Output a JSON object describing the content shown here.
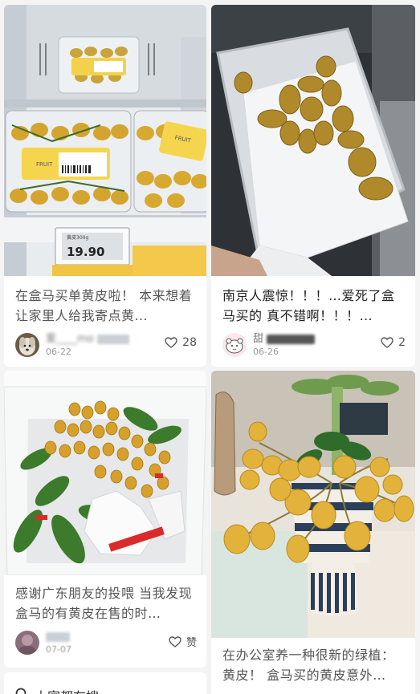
{
  "feed": {
    "cards": [
      {
        "title": "在盒马买单黄皮啦！ 本来想着让家里人给我寄点黄…",
        "user": "爱____mo",
        "date": "06-22",
        "likes": "28",
        "icon": "heart-icon",
        "image_labels": {
          "price": "19.90",
          "fruit": "FRUIT",
          "weight_tag": "黄皮300g"
        }
      },
      {
        "title": "南京人震惊！！！…爱死了盒马买的 真不错啊！！！…",
        "user": "甜",
        "date": "06-26",
        "likes": "2",
        "icon": "heart-icon"
      },
      {
        "title": "感谢广东朋友的投喂 当我发现盒马的有黄皮在售的时…",
        "user": "",
        "date": "07-07",
        "likes": "赞",
        "icon": "heart-icon"
      },
      {
        "title": "在办公室养一种很新的绿植：黄皮！ 盒马买的黄皮意外…",
        "user": "",
        "date": "",
        "likes": "",
        "icon": "heart-icon"
      }
    ],
    "partial_card": {
      "text": "大家都在搜",
      "icon": "search-icon"
    }
  }
}
